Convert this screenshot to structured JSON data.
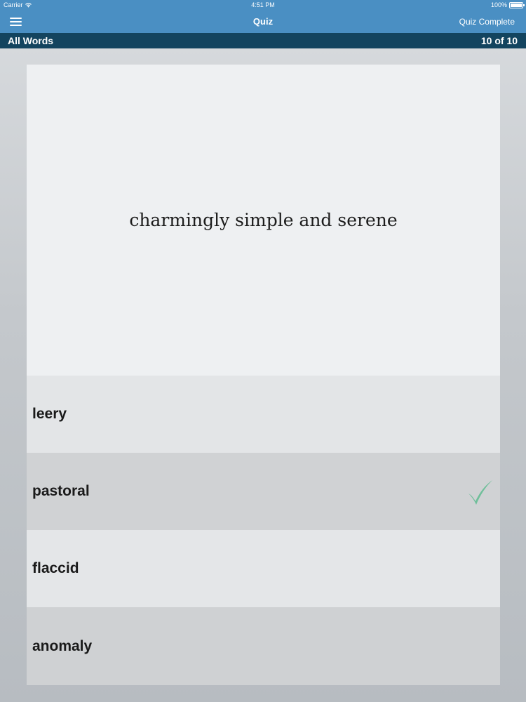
{
  "status_bar": {
    "carrier": "Carrier",
    "time": "4:51 PM",
    "battery": "100%"
  },
  "nav": {
    "title": "Quiz",
    "right_action": "Quiz Complete",
    "menu_icon": "hamburger-menu-icon"
  },
  "subbar": {
    "deck": "All Words",
    "progress": "10 of 10"
  },
  "quiz": {
    "prompt": "charmingly simple and serene",
    "answers": [
      {
        "label": "leery"
      },
      {
        "label": "pastoral",
        "correct": true,
        "icon": "checkmark-icon"
      },
      {
        "label": "flaccid"
      },
      {
        "label": "anomaly"
      }
    ]
  },
  "colors": {
    "nav_bar": "#4a8fc3",
    "sub_bar": "#13445f",
    "check": "#6fbf9a"
  }
}
